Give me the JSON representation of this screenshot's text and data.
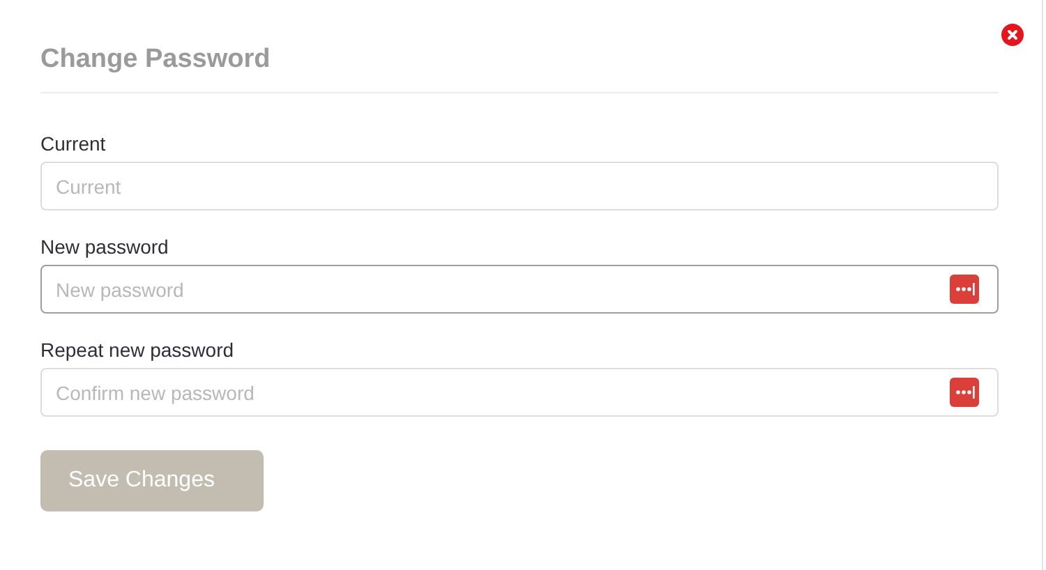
{
  "dialog": {
    "title": "Change Password"
  },
  "fields": [
    {
      "label": "Current",
      "placeholder": "Current",
      "focused": false,
      "password_manager": false
    },
    {
      "label": "New password",
      "placeholder": "New password",
      "focused": true,
      "password_manager": true
    },
    {
      "label": "Repeat new password",
      "placeholder": "Confirm new password",
      "focused": false,
      "password_manager": true
    }
  ],
  "save_button": {
    "label": "Save Changes",
    "disabled": true
  }
}
